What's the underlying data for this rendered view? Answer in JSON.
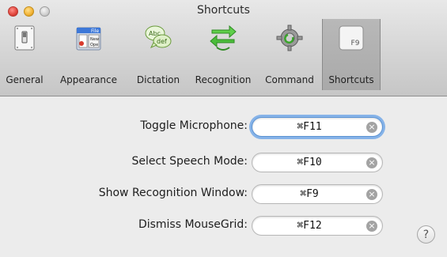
{
  "window": {
    "title": "Shortcuts"
  },
  "toolbar": {
    "items": [
      {
        "label": "General",
        "icon": "switch-icon"
      },
      {
        "label": "Appearance",
        "icon": "appearance-icon"
      },
      {
        "label": "Dictation",
        "icon": "speech-bubbles-icon"
      },
      {
        "label": "Recognition",
        "icon": "recognition-arrows-icon"
      },
      {
        "label": "Command",
        "icon": "gear-icon"
      },
      {
        "label": "Shortcuts",
        "icon": "function-key-icon",
        "key_text": "F9",
        "selected": true
      }
    ],
    "file_menu_text": [
      "File",
      "New",
      "Ope"
    ],
    "bubble_text": [
      "Abc",
      "def"
    ]
  },
  "shortcuts": [
    {
      "label": "Toggle Microphone:",
      "value": "⌘F11",
      "focused": true
    },
    {
      "label": "Select Speech Mode:",
      "value": "⌘F10"
    },
    {
      "label": "Show Recognition Window:",
      "value": "⌘F9"
    },
    {
      "label": "Dismiss MouseGrid:",
      "value": "⌘F12"
    }
  ],
  "help": {
    "label": "?"
  },
  "colors": {
    "focus_ring": "#86b3e8",
    "close": "#e0443b",
    "minimize": "#f2b235",
    "zoom_disabled": "#cfcfcf"
  }
}
